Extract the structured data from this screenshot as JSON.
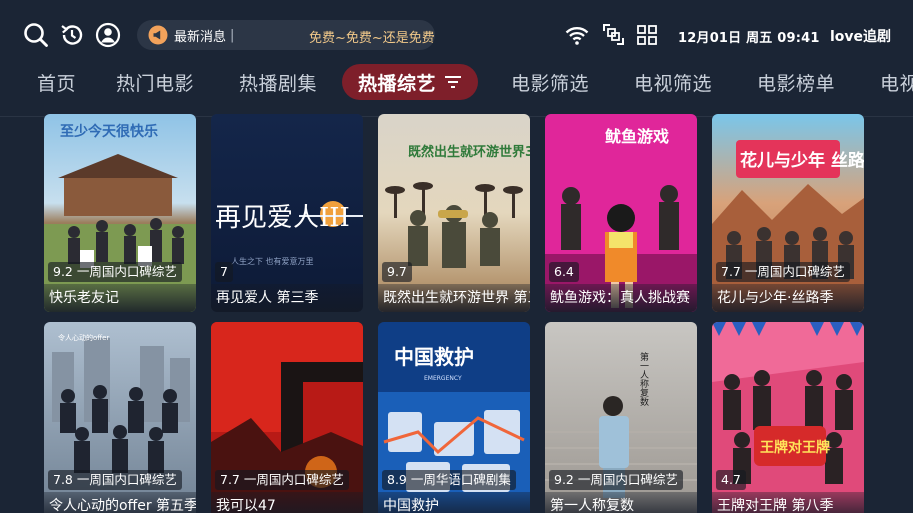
{
  "header": {
    "ticker_label": "最新消息",
    "ticker_sep": "|",
    "ticker_text": "免费~免费~还是免费",
    "clock": "12月01日 周五 09:41",
    "app_name": "love追剧",
    "icons": [
      "search-icon",
      "history-icon",
      "user-icon",
      "megaphone-icon",
      "wifi-icon",
      "resize-icon",
      "grid-icon"
    ]
  },
  "tabs": [
    {
      "label": "首页",
      "active": false
    },
    {
      "label": "热门电影",
      "active": false
    },
    {
      "label": "热播剧集",
      "active": false
    },
    {
      "label": "热播综艺",
      "active": true
    },
    {
      "label": "电影筛选",
      "active": false
    },
    {
      "label": "电视筛选",
      "active": false
    },
    {
      "label": "电影榜单",
      "active": false
    },
    {
      "label": "电视",
      "active": false
    }
  ],
  "colors": {
    "background": "#1b2535",
    "active_tab": "#7e1f2a",
    "ticker_text": "#f2c98a"
  },
  "cards": [
    {
      "badge": "9.2 一周国内口碑综艺",
      "title": "快乐老友记",
      "poster_text": "至少今天很快乐"
    },
    {
      "badge": "7",
      "title": "再见爱人 第三季",
      "poster_text": "再见爱人III"
    },
    {
      "badge": "9.7",
      "title": "既然出生就环游世界 第三季",
      "poster_text": "既然出生就环游世界3"
    },
    {
      "badge": "6.4",
      "title": "鱿鱼游戏：真人挑战赛",
      "poster_text": "鱿鱼游戏"
    },
    {
      "badge": "7.7 一周国内口碑综艺",
      "title": "花儿与少年·丝路季",
      "poster_text": "花儿与少年 丝路季"
    },
    {
      "badge": "7.8 一周国内口碑综艺",
      "title": "令人心动的offer 第五季",
      "poster_text": "令人心动的offer"
    },
    {
      "badge": "7.7 一周国内口碑综艺",
      "title": "我可以47",
      "poster_text": ""
    },
    {
      "badge": "8.9 一周华语口碑剧集",
      "title": "中国救护",
      "poster_text": "中国救护"
    },
    {
      "badge": "9.2 一周国内口碑综艺",
      "title": "第一人称复数",
      "poster_text": "第一人称复数"
    },
    {
      "badge": "4.7",
      "title": "王牌对王牌 第八季",
      "poster_text": "王牌对王牌"
    }
  ]
}
